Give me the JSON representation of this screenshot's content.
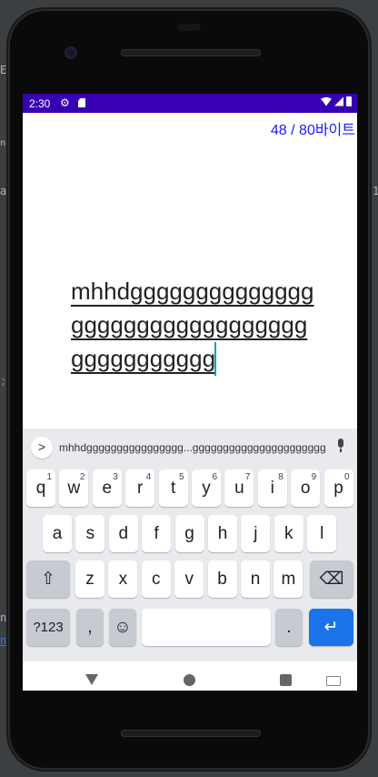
{
  "ide_fragments": {
    "left_e": "E",
    "left_na": "na",
    "left_al": "al",
    "left_semicolon": ";",
    "left_n": "n",
    "left_link": "n",
    "right_1": "1"
  },
  "statusbar": {
    "time": "2:30"
  },
  "app": {
    "byte_counter": "48 / 80바이트",
    "edit_text": "mhhdggggggggggggggggggggggggggggggggggggggggggg"
  },
  "keyboard": {
    "expand_icon": ">",
    "suggestion": "mhhdgggggggggggggggg...gggggggggggggggggggggg",
    "row1": [
      {
        "label": "q",
        "hint": "1"
      },
      {
        "label": "w",
        "hint": "2"
      },
      {
        "label": "e",
        "hint": "3"
      },
      {
        "label": "r",
        "hint": "4"
      },
      {
        "label": "t",
        "hint": "5"
      },
      {
        "label": "y",
        "hint": "6"
      },
      {
        "label": "u",
        "hint": "7"
      },
      {
        "label": "i",
        "hint": "8"
      },
      {
        "label": "o",
        "hint": "9"
      },
      {
        "label": "p",
        "hint": "0"
      }
    ],
    "row2": [
      "a",
      "s",
      "d",
      "f",
      "g",
      "h",
      "j",
      "k",
      "l"
    ],
    "row3": [
      "z",
      "x",
      "c",
      "v",
      "b",
      "n",
      "m"
    ],
    "shift_icon": "⇧",
    "backspace_icon": "⌫",
    "symbols_label": "?123",
    "comma_label": ",",
    "emoji_icon": "☺",
    "period_label": ".",
    "enter_icon": "↵"
  }
}
